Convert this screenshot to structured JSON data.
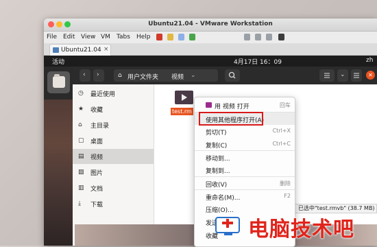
{
  "window": {
    "title": "Ubuntu21.04 - VMware Workstation"
  },
  "menubar": {
    "items": [
      "File",
      "Edit",
      "View",
      "VM",
      "Tabs",
      "Help"
    ]
  },
  "vm_tab": {
    "label": "Ubuntu21.04",
    "close": "×"
  },
  "topbar": {
    "activities": "活动",
    "clock": "4月17日  16：09",
    "lang": "zh"
  },
  "headerbar": {
    "path": [
      "用户文件夹",
      "视频"
    ],
    "search_icon": "search-icon",
    "back": "‹",
    "forward": "›",
    "dropdown": "⌄"
  },
  "sidebar": {
    "items": [
      {
        "icon": "◷",
        "label": "最近使用"
      },
      {
        "icon": "★",
        "label": "收藏"
      },
      {
        "icon": "⌂",
        "label": "主目录"
      },
      {
        "icon": "▢",
        "label": "桌面"
      },
      {
        "icon": "▤",
        "label": "视频"
      },
      {
        "icon": "▨",
        "label": "图片"
      },
      {
        "icon": "▥",
        "label": "文档"
      },
      {
        "icon": "⤓",
        "label": "下载"
      }
    ]
  },
  "file": {
    "name": "test.rm"
  },
  "context_menu": {
    "items": [
      {
        "label": "用 视频 打开",
        "key": "回车"
      },
      {
        "label": "使用其他程序打开(A)",
        "key": ""
      },
      {
        "label": "剪切(T)",
        "key": "Ctrl+X"
      },
      {
        "label": "复制(C)",
        "key": "Ctrl+C"
      },
      {
        "label": "移动到...",
        "key": ""
      },
      {
        "label": "复制到...",
        "key": ""
      },
      {
        "label": "回收(V)",
        "key": "删除"
      },
      {
        "label": "重命名(M)...",
        "key": "F2"
      },
      {
        "label": "压缩(O)...",
        "key": ""
      },
      {
        "label": "发送到...",
        "key": ""
      },
      {
        "label": "收藏",
        "key": ""
      }
    ]
  },
  "status": {
    "text": "已选中\"test.rmvb\" (38.7 MB)"
  },
  "watermark": {
    "text": "电脑技术吧"
  },
  "colors": {
    "accent": "#e95420",
    "highlight": "#d91919",
    "watermark": "#e0241b"
  }
}
